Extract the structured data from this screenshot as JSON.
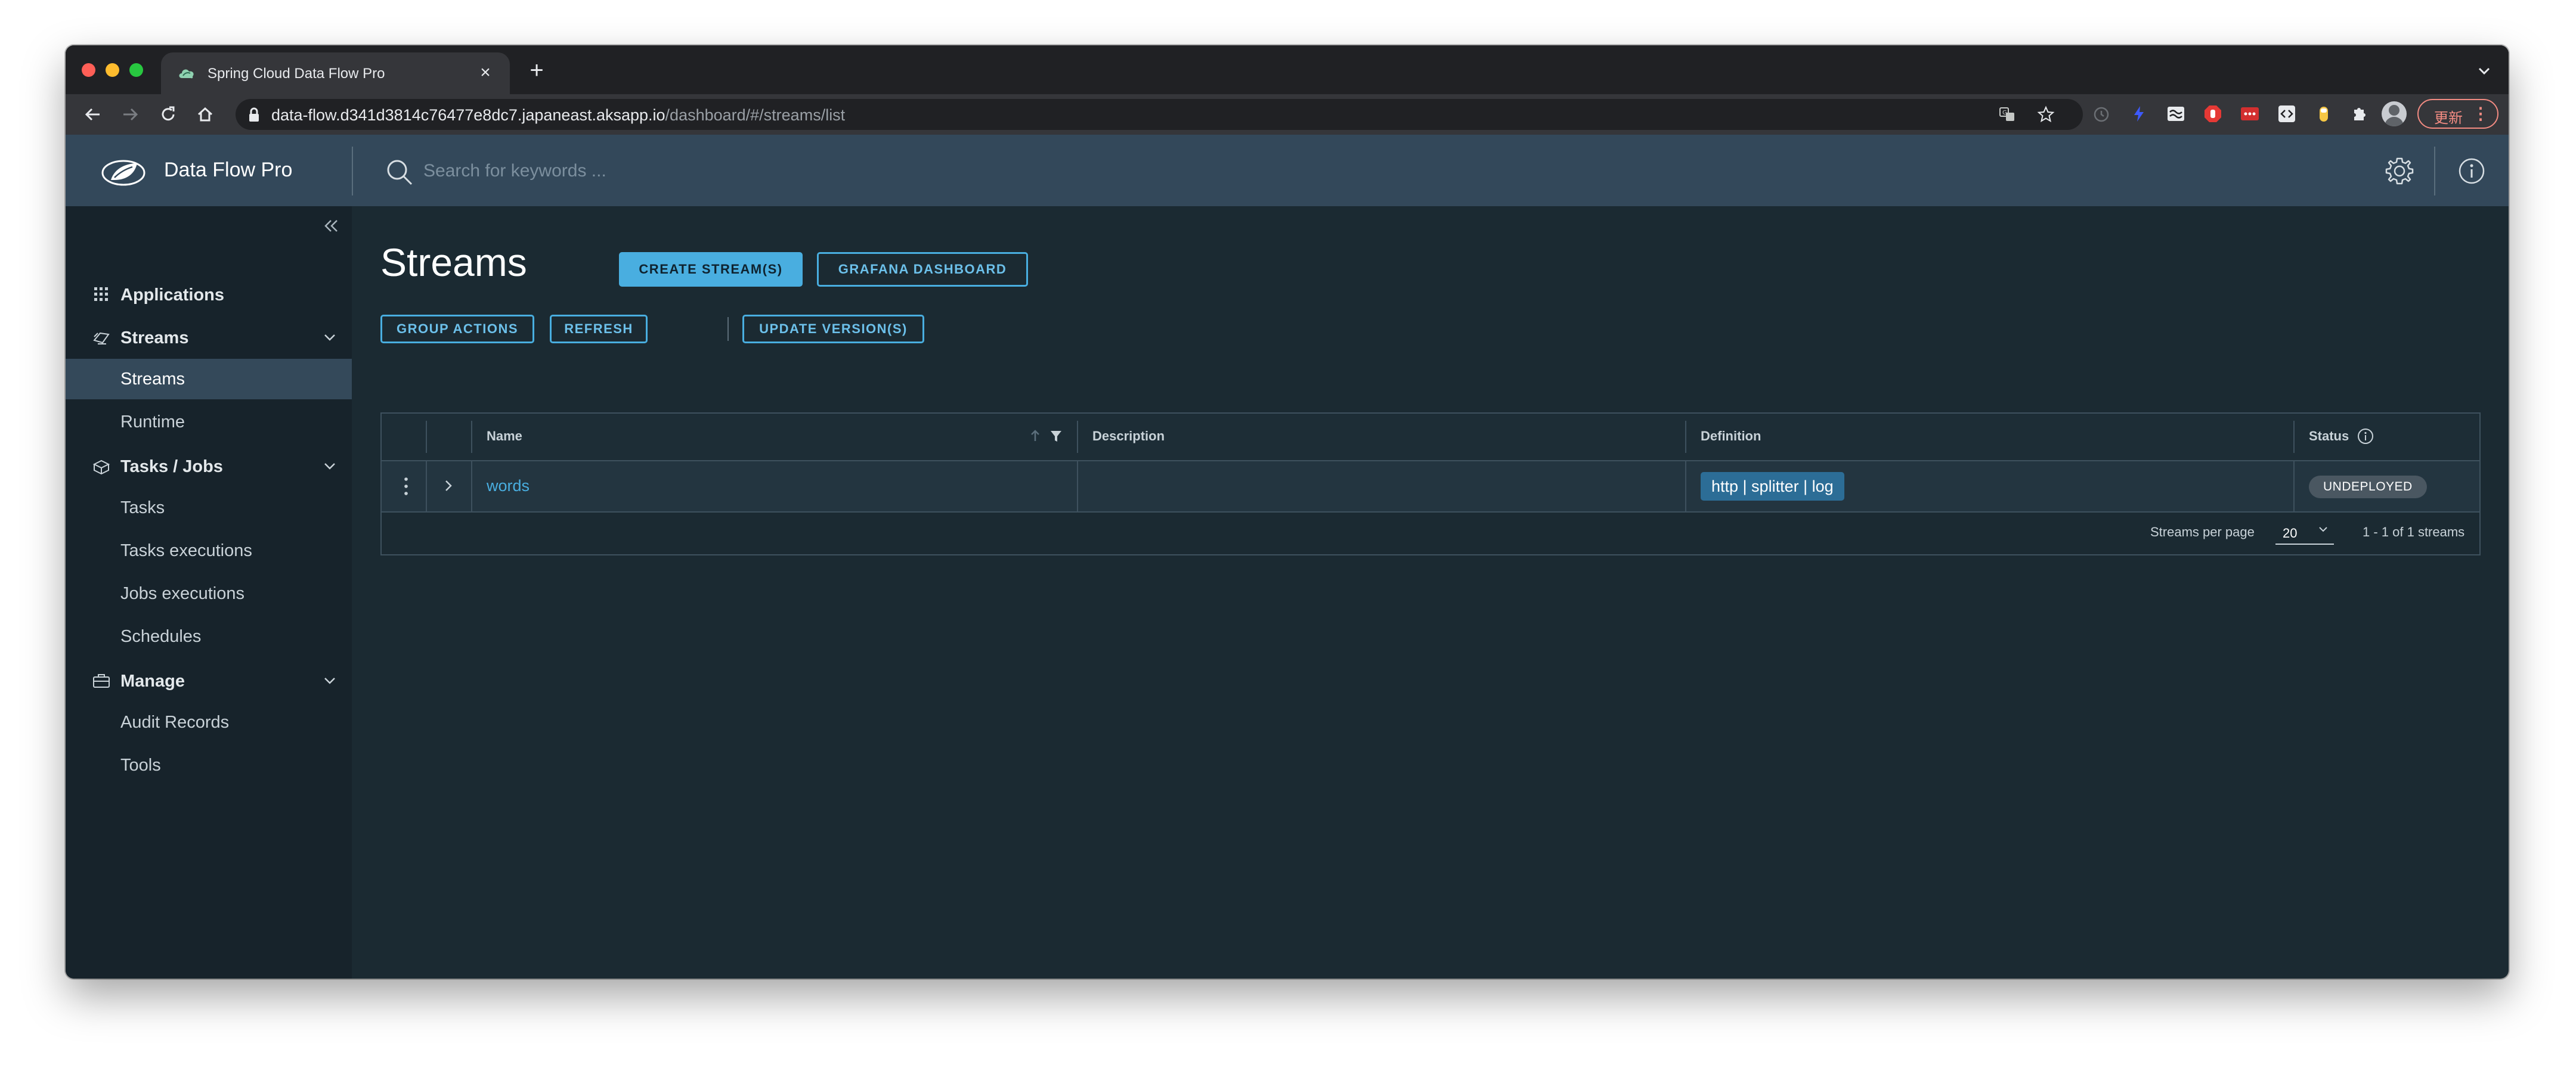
{
  "browser": {
    "tab_title": "Spring Cloud Data Flow Pro",
    "url_host": "data-flow.d341d3814c76477e8dc7.japaneast.aksapp.io",
    "url_path": "/dashboard/#/streams/list",
    "update_label": "更新"
  },
  "header": {
    "brand": "Data Flow Pro",
    "search_placeholder": "Search for keywords ..."
  },
  "sidebar": {
    "groups": [
      {
        "label": "Applications",
        "icon": "grid-icon"
      },
      {
        "label": "Streams",
        "icon": "streams-icon",
        "items": [
          {
            "label": "Streams",
            "active": true
          },
          {
            "label": "Runtime"
          }
        ]
      },
      {
        "label": "Tasks / Jobs",
        "icon": "tasks-icon",
        "items": [
          {
            "label": "Tasks"
          },
          {
            "label": "Tasks executions"
          },
          {
            "label": "Jobs executions"
          },
          {
            "label": "Schedules"
          }
        ]
      },
      {
        "label": "Manage",
        "icon": "briefcase-icon",
        "items": [
          {
            "label": "Audit Records"
          },
          {
            "label": "Tools"
          }
        ]
      }
    ]
  },
  "main": {
    "title": "Streams",
    "create_button": "CREATE STREAM(S)",
    "grafana_button": "GRAFANA DASHBOARD",
    "group_actions_button": "GROUP ACTIONS",
    "refresh_button": "REFRESH",
    "update_version_button": "UPDATE VERSION(S)",
    "columns": [
      "Name",
      "Description",
      "Definition",
      "Status"
    ],
    "rows": [
      {
        "name": "words",
        "description": "",
        "definition": "http | splitter | log",
        "status": "UNDEPLOYED"
      }
    ],
    "per_page_label": "Streams per page",
    "per_page_value": "20",
    "range_label": "1 - 1 of 1 streams"
  },
  "colors": {
    "accent": "#49aee0",
    "header_bg": "#33485a",
    "sidebar_bg": "#17232b",
    "content_bg": "#1b2a32"
  }
}
